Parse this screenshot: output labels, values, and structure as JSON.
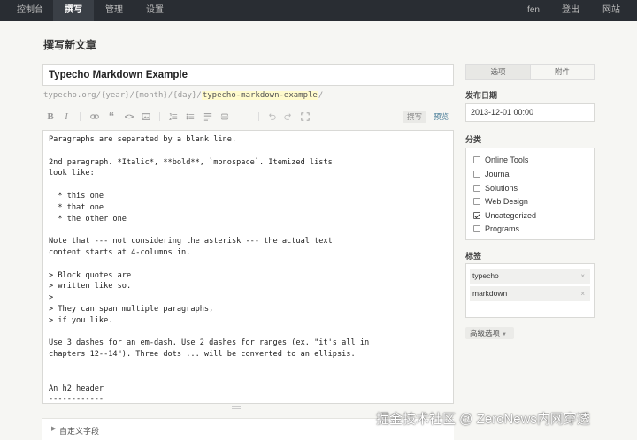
{
  "nav": {
    "left": [
      "控制台",
      "撰写",
      "管理",
      "设置"
    ],
    "right": [
      "fen",
      "登出",
      "网站"
    ],
    "active": "撰写"
  },
  "page_title": "撰写新文章",
  "post": {
    "title": "Typecho Markdown Example",
    "permalink_prefix": "typecho.org/{year}/{month}/{day}/",
    "slug": "typecho-markdown-example",
    "permalink_suffix": "/"
  },
  "toolbar": {
    "icons": [
      "bold-icon",
      "italic-icon",
      "link-icon",
      "blockquote-icon",
      "code-icon",
      "image-icon",
      "ordered-list-icon",
      "unordered-list-icon",
      "heading-icon",
      "horizontal-rule-icon",
      "undo-icon",
      "redo-icon",
      "fullscreen-icon"
    ],
    "bold": "B",
    "italic": "I",
    "quote": "“",
    "code": "<>",
    "write_label": "撰写",
    "preview_label": "预览"
  },
  "editor": {
    "content": "Paragraphs are separated by a blank line.\n\n2nd paragraph. *Italic*, **bold**, `monospace`. Itemized lists\nlook like:\n\n  * this one\n  * that one\n  * the other one\n\nNote that --- not considering the asterisk --- the actual text\ncontent starts at 4-columns in.\n\n> Block quotes are\n> written like so.\n>\n> They can span multiple paragraphs,\n> if you like.\n\nUse 3 dashes for an em-dash. Use 2 dashes for ranges (ex. \"it's all in\nchapters 12--14\"). Three dots ... will be converted to an ellipsis.\n\n\nAn h2 header\n------------"
  },
  "custom_fields_label": "自定义字段",
  "sidebar": {
    "tabs": [
      "选项",
      "附件"
    ],
    "publish_date_label": "发布日期",
    "publish_date": "2013-12-01 00:00",
    "category_label": "分类",
    "categories": [
      {
        "name": "Online Tools",
        "checked": false
      },
      {
        "name": "Journal",
        "checked": false
      },
      {
        "name": "Solutions",
        "checked": false
      },
      {
        "name": "Web Design",
        "checked": false
      },
      {
        "name": "Uncategorized",
        "checked": true
      },
      {
        "name": "Programs",
        "checked": false
      }
    ],
    "tags_label": "标签",
    "tags": [
      "typecho",
      "markdown"
    ],
    "tag_remove": "×",
    "advanced_label": "高级选项"
  },
  "watermark": "掘金技术社区 @ ZeroNews内网穿透"
}
